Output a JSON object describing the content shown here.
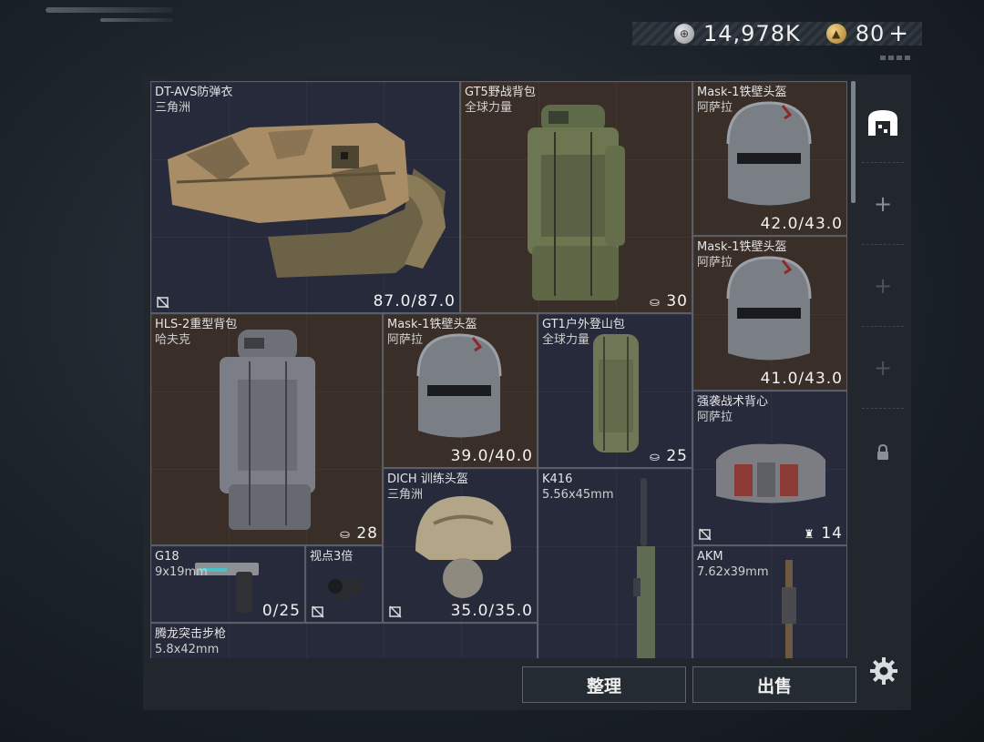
{
  "currency": {
    "silver_value": "14,978K",
    "gold_value": "80",
    "plus_label": "+",
    "silver_icon": "silver-coin-icon",
    "gold_icon": "gold-coin-icon"
  },
  "items": [
    {
      "name": "DT-AVS防弹衣",
      "sub": "三角洲",
      "value": "87.0/87.0"
    },
    {
      "name": "GT5野战背包",
      "sub": "全球力量",
      "value": "30"
    },
    {
      "name": "Mask-1铁壁头盔",
      "sub": "阿萨拉",
      "value": "42.0/43.0"
    },
    {
      "name": "Mask-1铁壁头盔",
      "sub": "阿萨拉",
      "value": "41.0/43.0"
    },
    {
      "name": "HLS-2重型背包",
      "sub": "哈夫克",
      "value": "28"
    },
    {
      "name": "Mask-1铁壁头盔",
      "sub": "阿萨拉",
      "value": "39.0/40.0"
    },
    {
      "name": "GT1户外登山包",
      "sub": "全球力量",
      "value": "25"
    },
    {
      "name": "强袭战术背心",
      "sub": "阿萨拉",
      "value": "14"
    },
    {
      "name": "DICH 训练头盔",
      "sub": "三角洲",
      "value": "35.0/35.0"
    },
    {
      "name": "K416",
      "sub": "5.56x45mm",
      "value": ""
    },
    {
      "name": "G18",
      "sub": "9x19mm",
      "value": "0/25"
    },
    {
      "name": "视点3倍",
      "sub": "",
      "value": ""
    },
    {
      "name": "AKM",
      "sub": "7.62x39mm",
      "value": ""
    },
    {
      "name": "腾龙突击步枪",
      "sub": "5.8x42mm",
      "value": ""
    }
  ],
  "sidebar": {
    "storage_icon": "storage-tab-icon",
    "plus_label": "+",
    "lock_icon": "lock-icon"
  },
  "buttons": {
    "organize": "整理",
    "sell": "出售"
  },
  "settings_icon": "gear-icon"
}
